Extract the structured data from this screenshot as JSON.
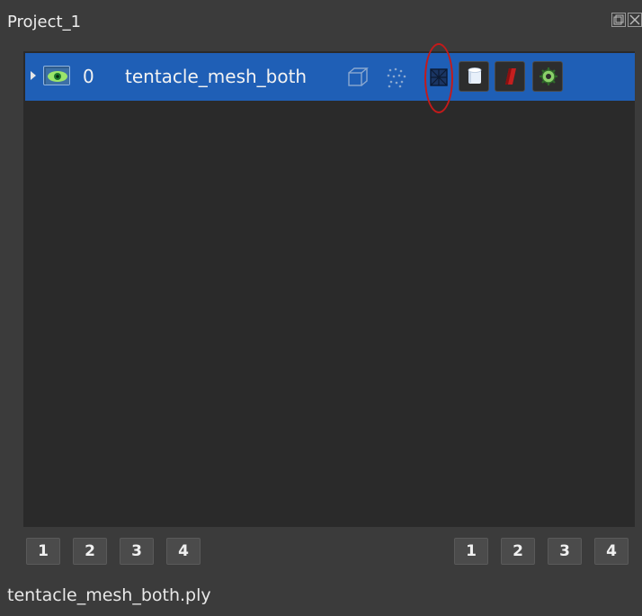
{
  "panel": {
    "title": "Project_1"
  },
  "tree": {
    "rows": [
      {
        "index": "0",
        "name": "tentacle_mesh_both"
      }
    ]
  },
  "view_buttons_left": [
    "1",
    "2",
    "3",
    "4"
  ],
  "view_buttons_right": [
    "1",
    "2",
    "3",
    "4"
  ],
  "footer": {
    "filename": "tentacle_mesh_both.ply"
  },
  "colors": {
    "selection": "#1f5fb6",
    "annotation": "#c41a1a",
    "background": "#3b3b3b",
    "tree_background": "#2a2a2a"
  },
  "icons": [
    "expand-arrow-icon",
    "eye-visibility-icon",
    "bounding-box-icon",
    "points-icon",
    "mesh-icon",
    "cylinder-icon",
    "color-brush-icon",
    "gear-icon",
    "restore-icon",
    "close-icon"
  ]
}
